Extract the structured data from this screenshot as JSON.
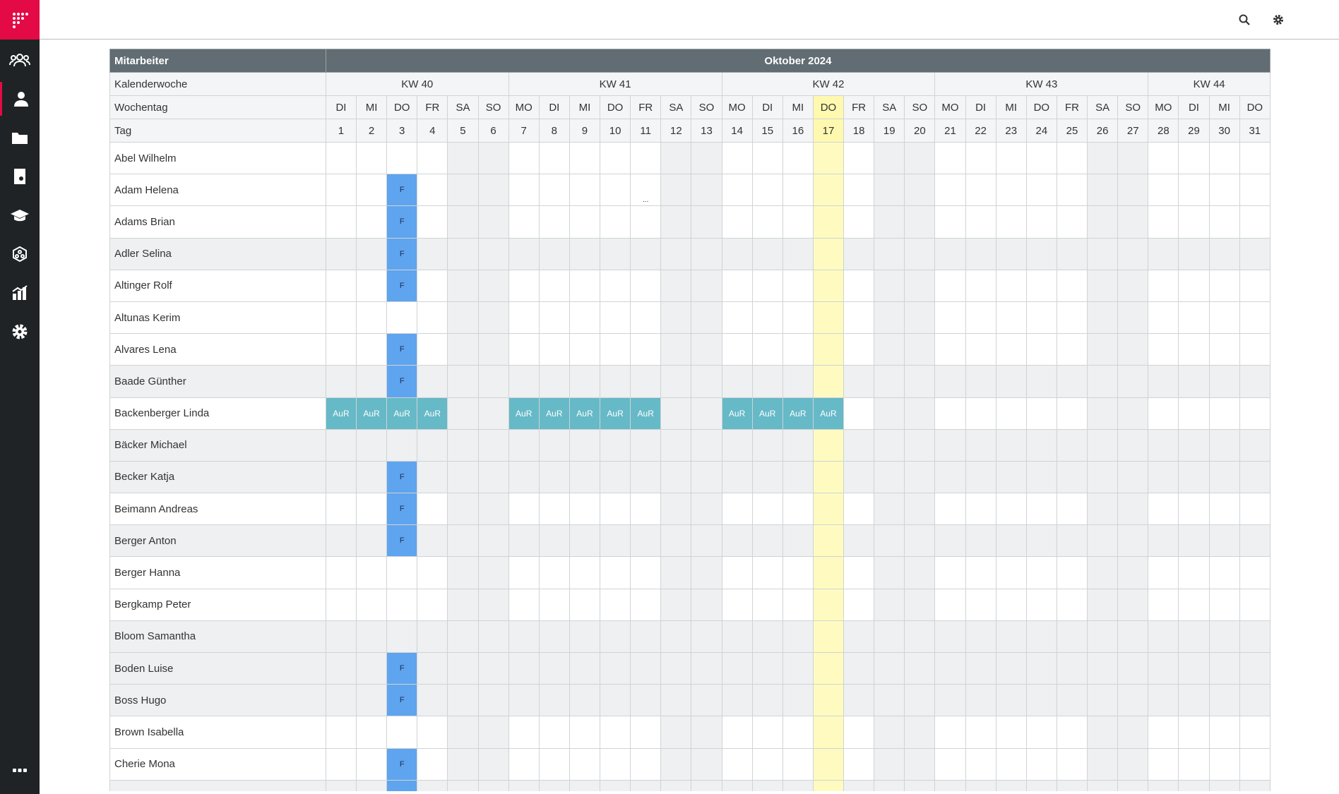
{
  "sidebar": {
    "logo_icon": "dot-grid-logo-icon",
    "items": [
      {
        "name": "team-icon"
      },
      {
        "name": "employee-icon",
        "active": true
      },
      {
        "name": "folder-icon"
      },
      {
        "name": "document-icon"
      },
      {
        "name": "graduation-cap-icon"
      },
      {
        "name": "network-icon"
      },
      {
        "name": "chart-icon"
      },
      {
        "name": "settings-gear-icon"
      }
    ],
    "more_icon": "more-dots-icon"
  },
  "topbar": {
    "icons": [
      "search-icon",
      "gear-icon"
    ],
    "avatar": "user-avatar"
  },
  "colors": {
    "brand": "#e30a45",
    "header": "#616d72",
    "today": "#fff9b0",
    "holiday_F": "#5fa4ee",
    "absence_AuR": "#66b9c7"
  },
  "calendar": {
    "employee_header": "Mitarbeiter",
    "month": "Oktober 2024",
    "kw_label": "Kalenderwoche",
    "weekday_label": "Wochentag",
    "day_label": "Tag",
    "today_index": 16,
    "weeks": [
      {
        "label": "KW 40",
        "span": 6
      },
      {
        "label": "KW 41",
        "span": 7
      },
      {
        "label": "KW 42",
        "span": 7
      },
      {
        "label": "KW 43",
        "span": 7
      },
      {
        "label": "KW 44",
        "span": 4
      }
    ],
    "weekdays": [
      "DI",
      "MI",
      "DO",
      "FR",
      "SA",
      "SO",
      "MO",
      "DI",
      "MI",
      "DO",
      "FR",
      "SA",
      "SO",
      "MO",
      "DI",
      "MI",
      "DO",
      "FR",
      "SA",
      "SO",
      "MO",
      "DI",
      "MI",
      "DO",
      "FR",
      "SA",
      "SO",
      "MO",
      "DI",
      "MI",
      "DO"
    ],
    "days": [
      "1",
      "2",
      "3",
      "4",
      "5",
      "6",
      "7",
      "8",
      "9",
      "10",
      "11",
      "12",
      "13",
      "14",
      "15",
      "16",
      "17",
      "18",
      "19",
      "20",
      "21",
      "22",
      "23",
      "24",
      "25",
      "26",
      "27",
      "28",
      "29",
      "30",
      "31"
    ],
    "employees": [
      {
        "name": "Abel Wilhelm",
        "dim": false,
        "marks": {}
      },
      {
        "name": "Adam Helena",
        "dim": false,
        "marks": {
          "2": "F",
          "10": "..."
        }
      },
      {
        "name": "Adams Brian",
        "dim": false,
        "marks": {
          "2": "F"
        }
      },
      {
        "name": "Adler Selina",
        "dim": true,
        "marks": {
          "2": "F"
        }
      },
      {
        "name": "Altinger Rolf",
        "dim": false,
        "marks": {
          "2": "F"
        }
      },
      {
        "name": "Altunas Kerim",
        "dim": false,
        "marks": {}
      },
      {
        "name": "Alvares Lena",
        "dim": false,
        "marks": {
          "2": "F"
        }
      },
      {
        "name": "Baade Günther",
        "dim": true,
        "marks": {
          "2": "F"
        }
      },
      {
        "name": "Backenberger Linda",
        "dim": false,
        "marks": {
          "0": "AuR",
          "1": "AuR",
          "2": "AuR",
          "3": "AuR",
          "6": "AuR",
          "7": "AuR",
          "8": "AuR",
          "9": "AuR",
          "10": "AuR",
          "13": "AuR",
          "14": "AuR",
          "15": "AuR",
          "16": "AuR"
        }
      },
      {
        "name": "Bäcker Michael",
        "dim": true,
        "marks": {}
      },
      {
        "name": "Becker Katja",
        "dim": true,
        "marks": {
          "2": "F"
        }
      },
      {
        "name": "Beimann Andreas",
        "dim": false,
        "marks": {
          "2": "F"
        }
      },
      {
        "name": "Berger Anton",
        "dim": true,
        "marks": {
          "2": "F"
        }
      },
      {
        "name": "Berger Hanna",
        "dim": false,
        "marks": {}
      },
      {
        "name": "Bergkamp Peter",
        "dim": false,
        "marks": {}
      },
      {
        "name": "Bloom Samantha",
        "dim": true,
        "marks": {}
      },
      {
        "name": "Boden Luise",
        "dim": true,
        "marks": {
          "2": "F"
        }
      },
      {
        "name": "Boss Hugo",
        "dim": true,
        "marks": {
          "2": "F"
        }
      },
      {
        "name": "Brown Isabella",
        "dim": false,
        "marks": {}
      },
      {
        "name": "Cherie Mona",
        "dim": false,
        "marks": {
          "2": "F"
        }
      },
      {
        "name": "",
        "dim": true,
        "marks": {
          "2": "F"
        }
      }
    ]
  }
}
